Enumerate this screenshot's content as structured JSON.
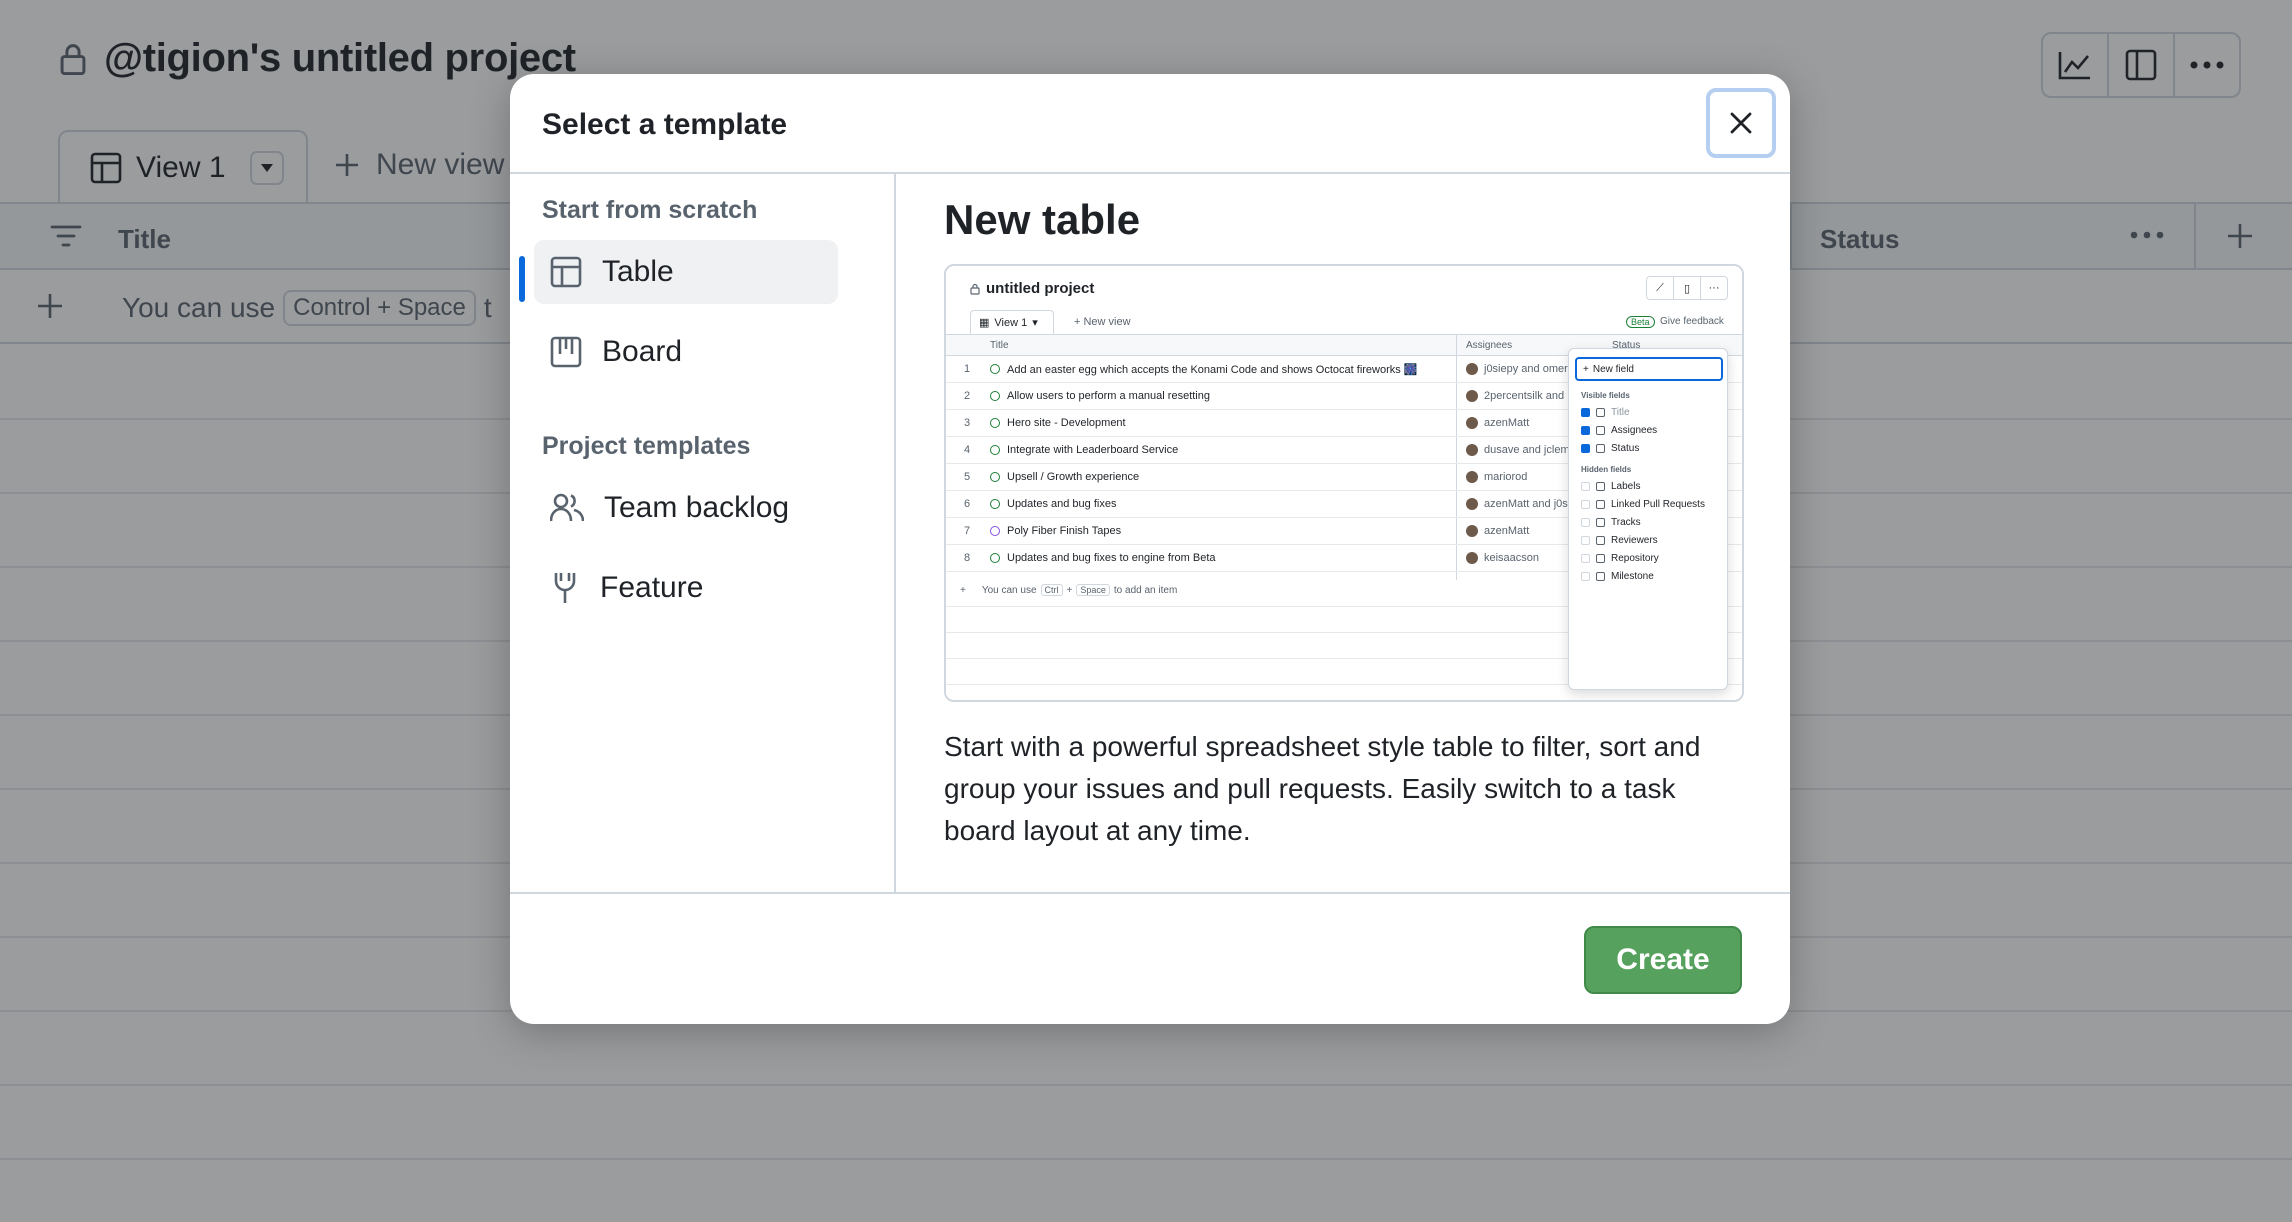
{
  "project": {
    "title": "@tigion's untitled project",
    "view_tab_label": "View 1",
    "new_view_label": "New view",
    "columns": [
      "Title",
      "Status"
    ],
    "add_item_hint_prefix": "You can use",
    "add_item_kbd": "Control + Space",
    "add_item_hint_suffix": "t"
  },
  "modal": {
    "title": "Select a template",
    "sections": [
      {
        "label": "Start from scratch",
        "items": [
          {
            "label": "Table",
            "icon": "table-icon",
            "selected": true
          },
          {
            "label": "Board",
            "icon": "board-icon",
            "selected": false
          }
        ]
      },
      {
        "label": "Project templates",
        "items": [
          {
            "label": "Team backlog",
            "icon": "people-icon",
            "selected": false
          },
          {
            "label": "Feature",
            "icon": "feature-icon",
            "selected": false
          }
        ]
      }
    ],
    "detail": {
      "title": "New table",
      "description": "Start with a powerful spreadsheet style table to filter, sort and group your issues and pull requests. Easily switch to a task board layout at any time."
    },
    "create_label": "Create",
    "accent": "#0969da",
    "create_color": "#57a15f"
  },
  "preview": {
    "title": "untitled project",
    "view_tab": "View 1",
    "new_view": "New view",
    "beta": "Beta",
    "feedback": "Give feedback",
    "headers": [
      "Title",
      "Assignees",
      "Status"
    ],
    "rows": [
      {
        "num": "1",
        "title": "Add an easter egg which accepts the Konami Code and shows Octocat fireworks 🎆",
        "assignees": "j0siepy and omer"
      },
      {
        "num": "2",
        "title": "Allow users to perform a manual resetting",
        "assignees": "2percentsilk and"
      },
      {
        "num": "3",
        "title": "Hero site - Development",
        "assignees": "azenMatt"
      },
      {
        "num": "4",
        "title": "Integrate with Leaderboard Service",
        "assignees": "dusave and jclem"
      },
      {
        "num": "5",
        "title": "Upsell / Growth experience",
        "assignees": "mariorod"
      },
      {
        "num": "6",
        "title": "Updates and bug fixes",
        "assignees": "azenMatt and j0s"
      },
      {
        "num": "7",
        "title": "Poly Fiber Finish Tapes",
        "assignees": "azenMatt"
      },
      {
        "num": "8",
        "title": "Updates and bug fixes to engine from Beta",
        "assignees": "keisaacson"
      }
    ],
    "add_hint_prefix": "You can use",
    "add_kbd_1": "Ctrl",
    "add_plus": "+",
    "add_kbd_2": "Space",
    "add_hint_suffix": "to add an item",
    "menu": {
      "new_field": "New field",
      "visible_label": "Visible fields",
      "visible": [
        "Title",
        "Assignees",
        "Status"
      ],
      "hidden_label": "Hidden fields",
      "hidden": [
        "Labels",
        "Linked Pull Requests",
        "Tracks",
        "Reviewers",
        "Repository",
        "Milestone"
      ]
    }
  }
}
